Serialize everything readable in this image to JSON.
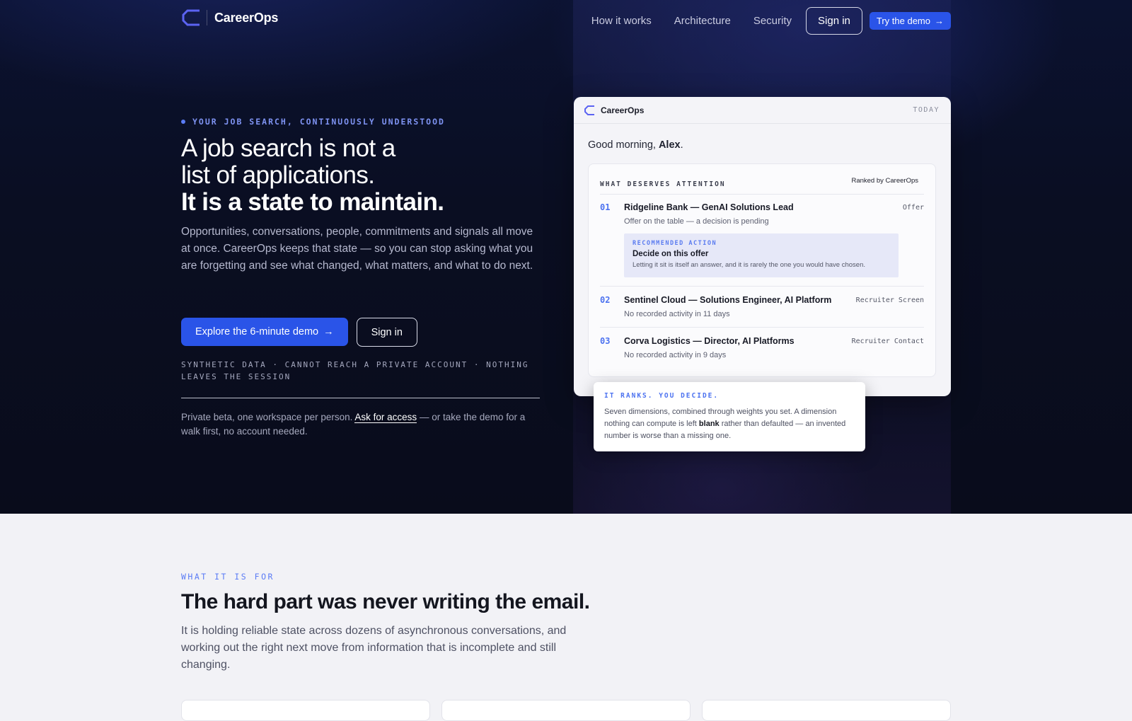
{
  "nav": {
    "brand": "CareerOps",
    "links": [
      "How it works",
      "Architecture",
      "Security"
    ],
    "sign_in": "Sign in",
    "demo": "Try the demo",
    "demo_arrow": "→"
  },
  "hero": {
    "eyebrow": "YOUR JOB SEARCH, CONTINUOUSLY UNDERSTOOD",
    "headline_line1": "A job search is not a",
    "headline_line2": "list of applications.",
    "headline_line3": "It is a state to maintain.",
    "lede": "Opportunities, conversations, people, commitments and signals all move at once. CareerOps keeps that state — so you can stop asking what you are forgetting and see what changed, what matters, and what to do next.",
    "primary_cta": "Explore the 6-minute demo",
    "primary_cta_arrow": "→",
    "secondary_cta": "Sign in",
    "fineprint": "SYNTHETIC DATA · CANNOT REACH A PRIVATE ACCOUNT · NOTHING LEAVES THE SESSION",
    "beta_prefix": "Private beta, one workspace per person.",
    "beta_link": "Ask for access",
    "beta_suffix": "— or take the demo for a walk first, no account needed."
  },
  "mock": {
    "brand": "CareerOps",
    "today": "TODAY",
    "greeting_prefix": "Good morning,",
    "greeting_name": "Alex",
    "greeting_suffix": ".",
    "attention_title": "WHAT DESERVES ATTENTION",
    "ranked_by": "Ranked by CareerOps",
    "items": [
      {
        "num": "01",
        "title": "Ridgeline Bank — GenAI Solutions Lead",
        "tag": "Offer",
        "sub": "Offer on the table — a decision is pending"
      },
      {
        "num": "02",
        "title": "Sentinel Cloud — Solutions Engineer, AI Platform",
        "tag": "Recruiter Screen",
        "sub": "No recorded activity in 11 days"
      },
      {
        "num": "03",
        "title": "Corva Logistics — Director, AI Platforms",
        "tag": "Recruiter Contact",
        "sub": "No recorded activity in 9 days"
      }
    ],
    "recommendation": {
      "label": "RECOMMENDED ACTION",
      "title": "Decide on this offer",
      "text": "Letting it sit is itself an answer, and it is rarely the one you would have chosen."
    }
  },
  "callout": {
    "label": "IT RANKS. YOU DECIDE.",
    "text_prefix": "Seven dimensions, combined through weights you set. A dimension nothing can compute is left",
    "text_bold": "blank",
    "text_suffix": "rather than defaulted — an invented number is worse than a missing one."
  },
  "section": {
    "eyebrow": "WHAT IT IS FOR",
    "title": "The hard part was never writing the email.",
    "body": "It is holding reliable state across dozens of asynchronous conversations, and working out the right next move from information that is incomplete and still changing."
  },
  "colors": {
    "accent": "#2a54e8",
    "accent_light": "#5b7cf5",
    "hero_bg": "#0a0e22",
    "section_bg": "#f2f2f6"
  }
}
